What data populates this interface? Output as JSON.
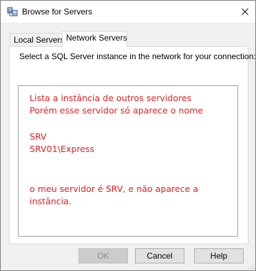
{
  "window": {
    "title": "Browse for Servers",
    "close_icon": "close-icon",
    "app_icon": "server-network-icon"
  },
  "tabs": [
    {
      "label": "Local Servers",
      "active": false
    },
    {
      "label": "Network Servers",
      "active": true
    }
  ],
  "panel": {
    "instruction": "Select a SQL Server instance in the network for your connection:",
    "annotation_color": "#e02020",
    "annotation_lines": [
      "Lista a instância de outros servidores",
      "Porém esse servidor só aparece o nome",
      "SRV",
      "SRV01\\Express",
      "o meu servidor é SRV, e não aparece a",
      "instância."
    ]
  },
  "buttons": {
    "ok": {
      "label": "OK",
      "enabled": false
    },
    "cancel": {
      "label": "Cancel",
      "enabled": true
    },
    "help": {
      "label": "Help",
      "enabled": true
    }
  }
}
